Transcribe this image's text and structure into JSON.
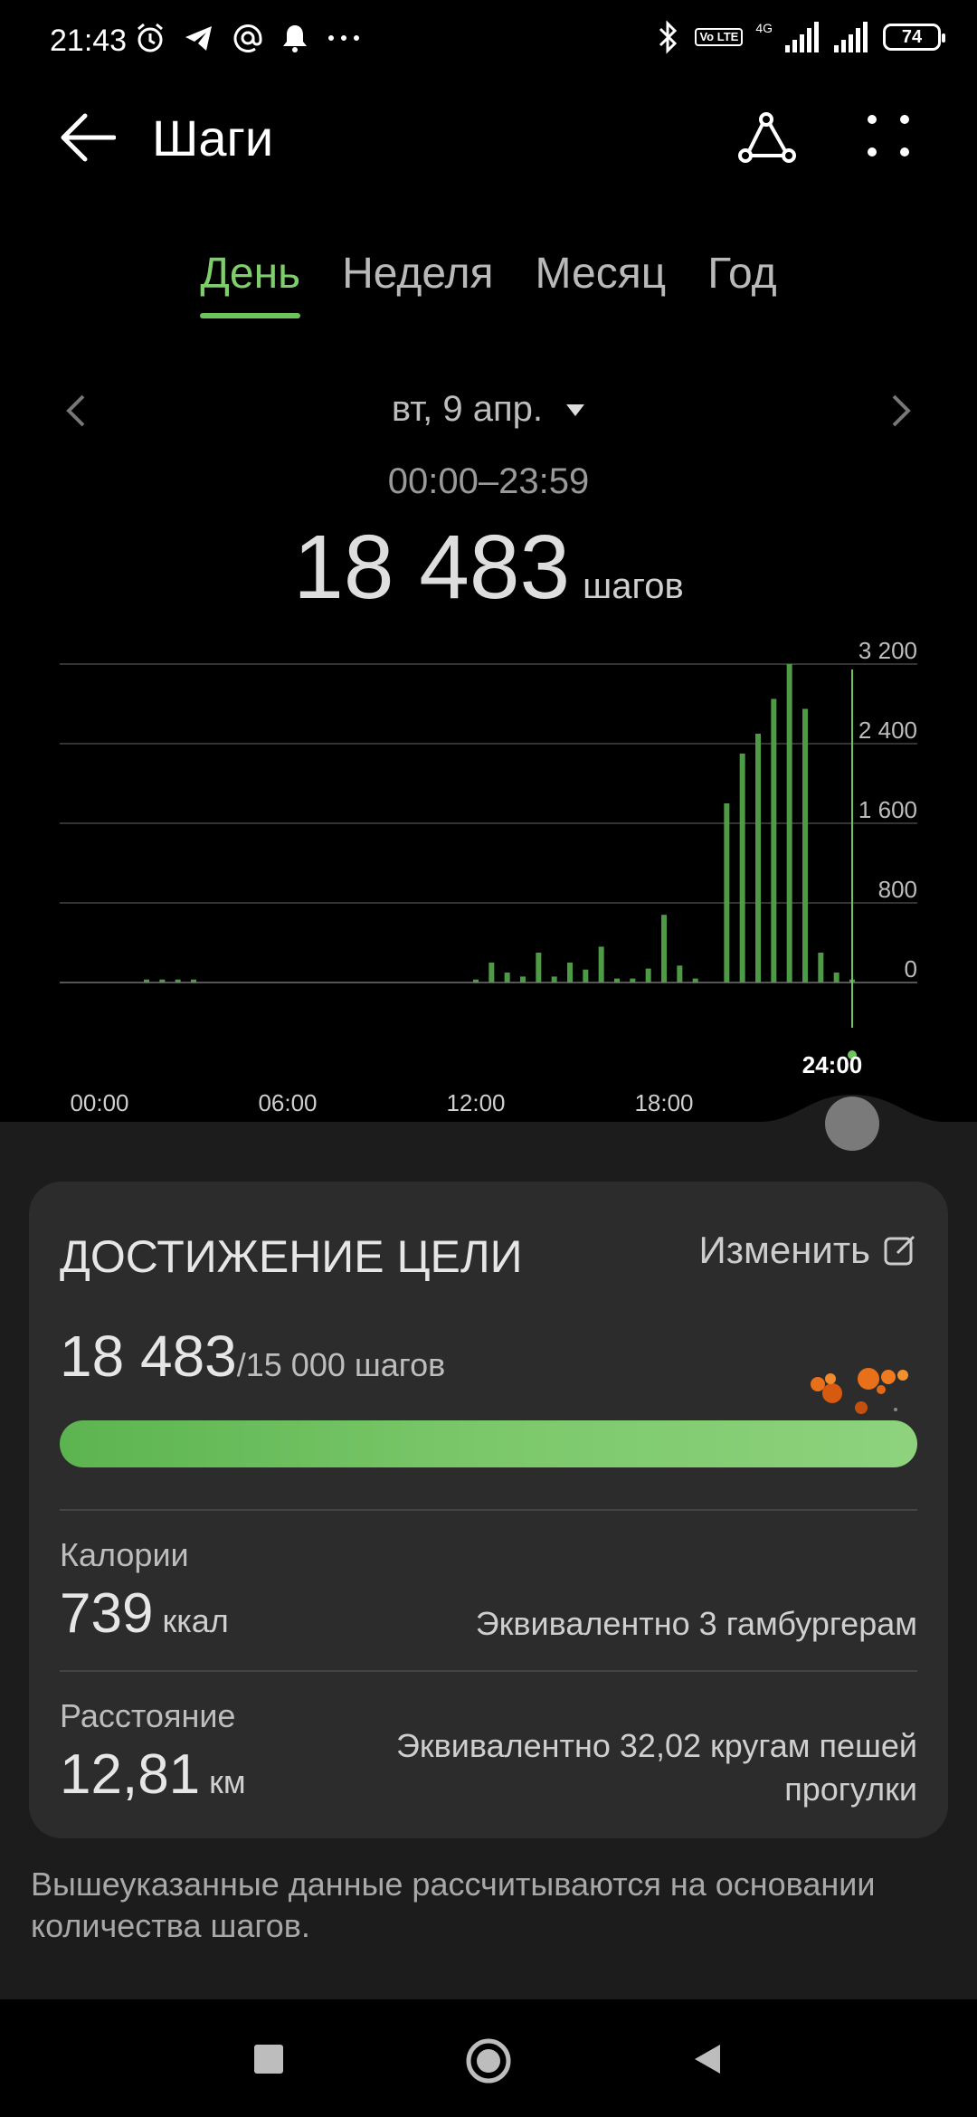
{
  "status_bar": {
    "time": "21:43",
    "network_type": "4G",
    "volte": "Vo LTE",
    "battery": "74",
    "icons_left": [
      "alarm-icon",
      "telegram-icon",
      "at-icon",
      "bell-icon",
      "more-dots-icon"
    ],
    "icons_right": [
      "bluetooth-icon",
      "volte-icon",
      "signal-icon",
      "signal-icon",
      "battery-icon"
    ]
  },
  "header": {
    "title": "Шаги"
  },
  "tabs": [
    {
      "label": "День",
      "active": true
    },
    {
      "label": "Неделя",
      "active": false
    },
    {
      "label": "Месяц",
      "active": false
    },
    {
      "label": "Год",
      "active": false
    }
  ],
  "date_selector": {
    "date": "вт, 9 апр.",
    "time_range": "00:00–23:59"
  },
  "total": {
    "value": "18 483",
    "unit": "шагов"
  },
  "colors": {
    "accent": "#7ecf6b",
    "bar": "#4e9a45",
    "background": "#000000",
    "card": "#2c2c2c",
    "progress": "#7bc86a"
  },
  "chart_data": {
    "type": "bar",
    "title": "",
    "xlabel": "",
    "ylabel": "",
    "ylim": [
      0,
      3200
    ],
    "y_ticks": [
      "3 200",
      "2 400",
      "1 600",
      "800",
      "0"
    ],
    "y_tick_values": [
      3200,
      2400,
      1600,
      800,
      0
    ],
    "x_ticks": [
      "00:00",
      "06:00",
      "12:00",
      "18:00"
    ],
    "x_tick_hours": [
      0,
      6,
      12,
      18
    ],
    "current_marker": "24:00",
    "xlim_hours": [
      0,
      24
    ],
    "grid": true,
    "series": [
      {
        "x_hours": [
          1.5,
          2.0,
          2.5,
          3.0,
          12.0,
          12.5,
          13.0,
          13.5,
          14.0,
          14.5,
          15.0,
          15.5,
          16.0,
          16.5,
          17.0,
          17.5,
          18.0,
          18.5,
          19.0,
          20.0,
          20.5,
          21.0,
          21.5,
          22.0,
          22.5,
          23.0,
          23.5,
          24.0
        ],
        "values": [
          30,
          30,
          30,
          30,
          30,
          200,
          100,
          60,
          300,
          60,
          200,
          130,
          360,
          40,
          40,
          140,
          680,
          170,
          40,
          1800,
          2300,
          2500,
          2850,
          3200,
          2750,
          300,
          100,
          30
        ]
      }
    ]
  },
  "goal_card": {
    "title": "ДОСТИЖЕНИЕ ЦЕЛИ",
    "edit_label": "Изменить",
    "current": "18 483",
    "target": "/15 000 шагов",
    "progress_fraction": 1.0,
    "calories_label": "Калории",
    "calories_value": "739",
    "calories_unit": "ккал",
    "calories_equiv": "Эквивалентно 3 гамбургерам",
    "distance_label": "Расстояние",
    "distance_value": "12,81",
    "distance_unit": "км",
    "distance_equiv_line1": "Эквивалентно 32,02 кругам пешей",
    "distance_equiv_line2": "прогулки"
  },
  "footnote": "Вышеуказанные данные рассчитываются на основании количества шагов.",
  "nav": {
    "recent": "recent-apps-button",
    "home": "home-button",
    "back": "back-button"
  }
}
